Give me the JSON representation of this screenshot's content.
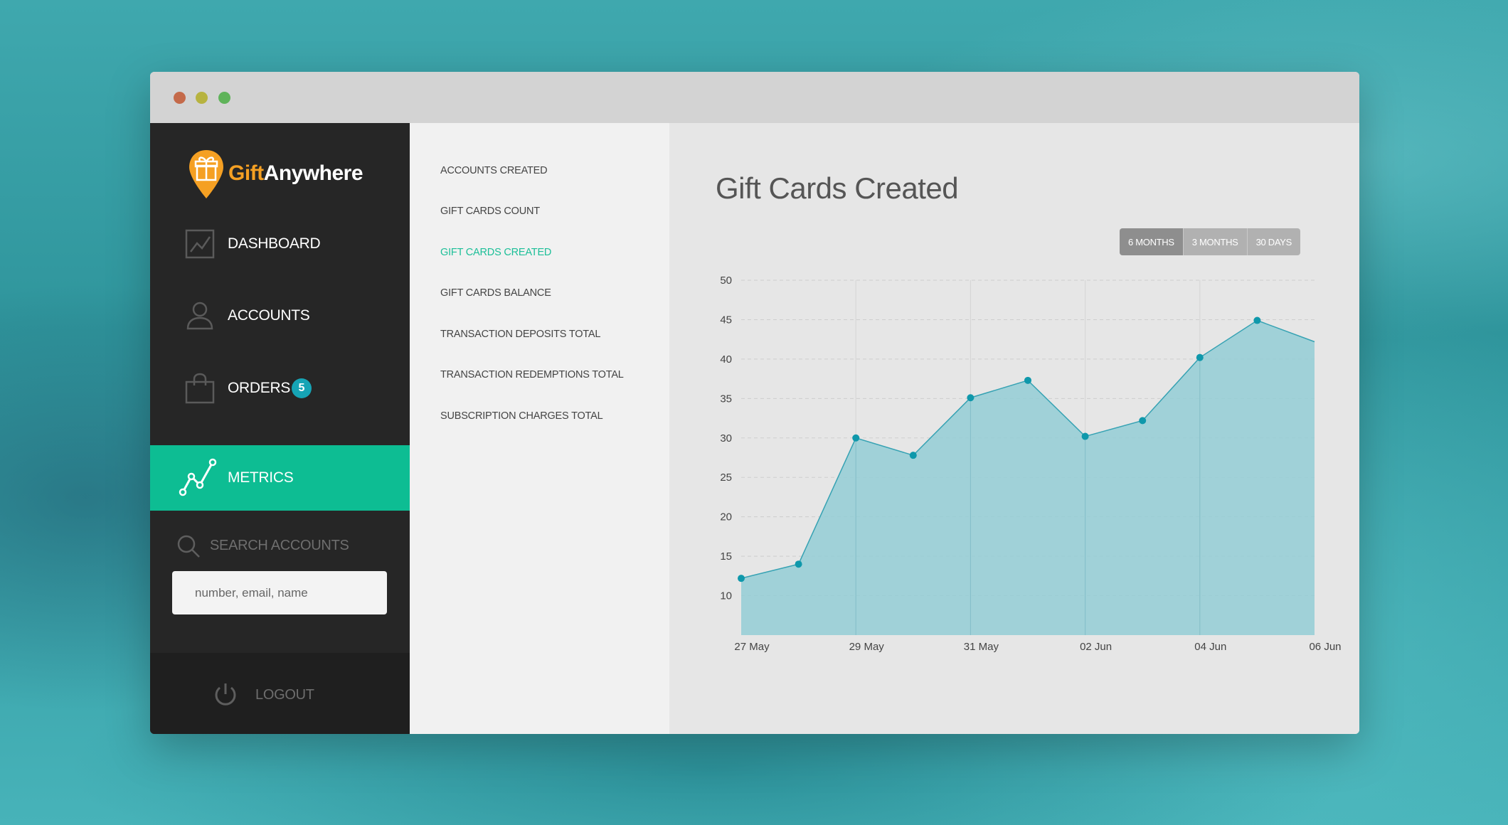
{
  "window": {
    "controls": [
      "close",
      "minimize",
      "maximize"
    ],
    "colors": {
      "close": "#c46a4a",
      "minimize": "#b7b340",
      "maximize": "#5fb35a"
    }
  },
  "brand": {
    "part1": "Gift",
    "part2": "Anywhere",
    "icon": "gift-pin-icon",
    "color": "#f5a023"
  },
  "sidebar": {
    "items": [
      {
        "label": "DASHBOARD",
        "icon": "dashboard-chart-icon"
      },
      {
        "label": "ACCOUNTS",
        "icon": "user-icon"
      },
      {
        "label": "ORDERS",
        "icon": "shopping-bag-icon",
        "badge": "5"
      },
      {
        "label": "METRICS",
        "icon": "metrics-line-icon",
        "active": true
      }
    ],
    "active_color": "#0dbd93",
    "search": {
      "title": "SEARCH ACCOUNTS",
      "placeholder": "number, email, name",
      "value": ""
    },
    "logout": {
      "label": "LOGOUT",
      "icon": "power-icon"
    }
  },
  "submenu": {
    "items": [
      "ACCOUNTS CREATED",
      "GIFT CARDS COUNT",
      "GIFT CARDS CREATED",
      "GIFT CARDS BALANCE",
      "TRANSACTION DEPOSITS TOTAL",
      "TRANSACTION REDEMPTIONS TOTAL",
      "SUBSCRIPTION CHARGES TOTAL"
    ],
    "active_index": 2,
    "active_color": "#1cbf98"
  },
  "main": {
    "title": "Gift Cards Created",
    "ranges": [
      "6 MONTHS",
      "3 MONTHS",
      "30 DAYS"
    ],
    "active_range": 0
  },
  "chart_data": {
    "type": "area",
    "title": "Gift Cards Created",
    "xlabel": "",
    "ylabel": "",
    "x": [
      "27 May",
      "",
      "29 May",
      "",
      "31 May",
      "",
      "02 Jun",
      "",
      "04 Jun",
      "",
      "06 Jun"
    ],
    "x_tick_labels": [
      "27 May",
      "29 May",
      "31 May",
      "02 Jun",
      "04 Jun",
      "06 Jun"
    ],
    "values": [
      12.2,
      14,
      30,
      27.8,
      35.1,
      37.3,
      30.2,
      32.2,
      40.2,
      44.9,
      42.2
    ],
    "y_ticks": [
      10,
      15,
      20,
      25,
      30,
      35,
      40,
      45,
      50
    ],
    "ylim": [
      5,
      50
    ],
    "grid": true,
    "colors": {
      "fill": "#93ccd5",
      "line": "#36a2b3",
      "marker": "#0f98ab"
    }
  }
}
